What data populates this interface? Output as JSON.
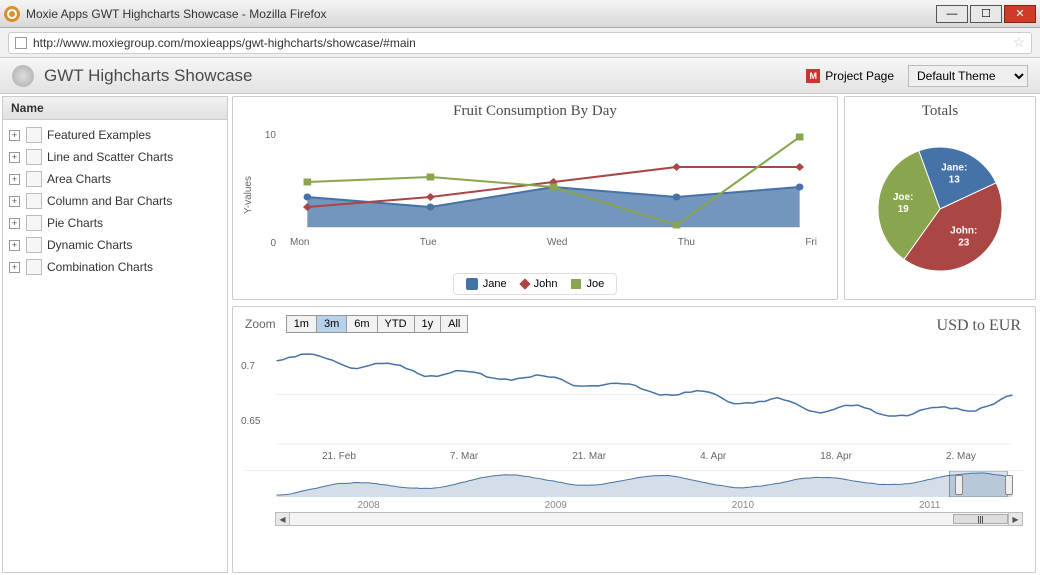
{
  "window": {
    "title": "Moxie Apps GWT Highcharts Showcase - Mozilla Firefox"
  },
  "urlbar": {
    "url": "http://www.moxiegroup.com/moxieapps/gwt-highcharts/showcase/#main"
  },
  "app": {
    "title": "GWT Highcharts Showcase",
    "project_link": "Project Page",
    "project_icon_text": "M",
    "theme_selected": "Default Theme"
  },
  "sidebar": {
    "header": "Name",
    "items": [
      {
        "label": "Featured Examples"
      },
      {
        "label": "Line and Scatter Charts"
      },
      {
        "label": "Area Charts"
      },
      {
        "label": "Column and Bar Charts"
      },
      {
        "label": "Pie Charts"
      },
      {
        "label": "Dynamic Charts"
      },
      {
        "label": "Combination Charts"
      }
    ]
  },
  "chart_data": [
    {
      "type": "area-line-combo",
      "title": "Fruit Consumption By Day",
      "ylabel": "Y-values",
      "categories": [
        "Mon",
        "Tue",
        "Wed",
        "Thu",
        "Fri"
      ],
      "ylim": [
        0,
        10
      ],
      "series": [
        {
          "name": "Jane",
          "style": "area",
          "color": "#4572a7",
          "values": [
            3,
            2,
            4,
            3,
            4
          ]
        },
        {
          "name": "John",
          "style": "line",
          "color": "#aa4643",
          "marker": "diamond",
          "values": [
            2,
            3,
            4.5,
            6,
            6
          ]
        },
        {
          "name": "Joe",
          "style": "line",
          "color": "#89a54e",
          "marker": "square",
          "values": [
            4.5,
            5,
            4,
            0.2,
            9
          ]
        }
      ]
    },
    {
      "type": "pie",
      "title": "Totals",
      "series": [
        {
          "name": "Jane",
          "value": 13,
          "color": "#4572a7"
        },
        {
          "name": "John",
          "value": 23,
          "color": "#aa4643"
        },
        {
          "name": "Joe",
          "value": 19,
          "color": "#89a54e"
        }
      ]
    },
    {
      "type": "line",
      "title": "USD to EUR",
      "zoom_label": "Zoom",
      "zoom_options": [
        "1m",
        "3m",
        "6m",
        "YTD",
        "1y",
        "All"
      ],
      "zoom_active": "3m",
      "ylim": [
        0.65,
        0.75
      ],
      "yticks": [
        0.7,
        0.65
      ],
      "xticks": [
        "21. Feb",
        "7. Mar",
        "21. Mar",
        "4. Apr",
        "18. Apr",
        "2. May"
      ],
      "navigator_years": [
        "2008",
        "2009",
        "2010",
        "2011"
      ]
    }
  ]
}
